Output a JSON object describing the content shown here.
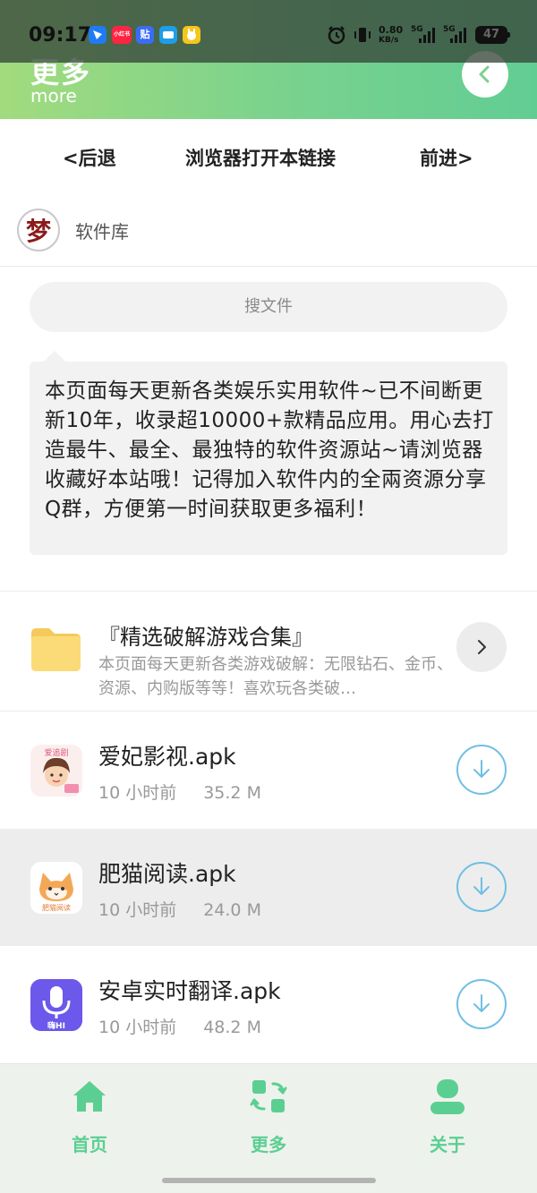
{
  "status_bar": {
    "time": "09:17",
    "apps": [
      {
        "icon": "app-feishu-icon",
        "color": "#1f7bf2",
        "text": ""
      },
      {
        "icon": "app-xiaohongshu-icon",
        "color": "#ff2442",
        "text": "小红书"
      },
      {
        "icon": "app-tieba-icon",
        "color": "#3b6cf5",
        "text": "贴"
      },
      {
        "icon": "app-alipay-icon",
        "color": "#1e9ee8",
        "text": ""
      },
      {
        "icon": "app-pet-icon",
        "color": "#f6c61b",
        "text": ""
      }
    ],
    "net_speed": "0.80",
    "net_unit": "KB/s",
    "signal_1": "5G",
    "signal_2": "5G",
    "battery": "47"
  },
  "header": {
    "title": "更多",
    "subtitle": "more",
    "back_icon": "chevron-left-icon"
  },
  "nav": {
    "back": "<后退",
    "open_in_browser": "浏览器打开本链接",
    "forward": "前进>"
  },
  "channel": {
    "logo_text": "梦",
    "name": "软件库"
  },
  "search": {
    "placeholder": "搜文件"
  },
  "notice": {
    "text": "本页面每天更新各类娱乐实用软件~已不间断更新10年，收录超10000+款精品应用。用心去打造最牛、最全、最独特的软件资源站~请浏览器收藏好本站哦！记得加入软件内的全兩资源分享Q群，方便第一时间获取更多福利！"
  },
  "folder": {
    "title": "『精选破解游戏合集』",
    "description": "本页面每天更新各类游戏破解：无限钻石、金币、资源、内购版等等！喜欢玩各类破…",
    "icon": "folder-icon"
  },
  "files": [
    {
      "name": "爱妃影视.apk",
      "time": "10 小时前",
      "size": "35.2 M",
      "icon_label": "爱追剧"
    },
    {
      "name": "肥猫阅读.apk",
      "time": "10 小时前",
      "size": "24.0 M",
      "icon_label": "肥猫阅读"
    },
    {
      "name": "安卓实时翻译.apk",
      "time": "10 小时前",
      "size": "48.2 M",
      "icon_label": "嗨HI"
    }
  ],
  "tabs": [
    {
      "label": "首页",
      "icon": "home-icon"
    },
    {
      "label": "更多",
      "icon": "more-apps-icon"
    },
    {
      "label": "关于",
      "icon": "user-icon"
    }
  ],
  "colors": {
    "accent": "#5bcf92",
    "header_start": "#a2db7e",
    "header_end": "#62cd93",
    "download": "#6fbfe4"
  }
}
